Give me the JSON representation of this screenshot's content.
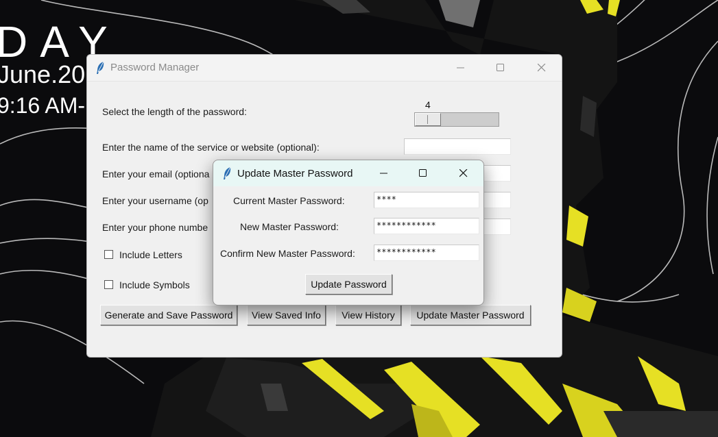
{
  "desktop": {
    "clock_day": "DAY",
    "clock_date": "June.20",
    "clock_time": "9:16 AM-"
  },
  "main_window": {
    "title": "Password Manager",
    "length_label": "Select the length of the password:",
    "length_value": "4",
    "service_label": "Enter the name of the service or website (optional):",
    "email_label": "Enter your email (optiona",
    "username_label": "Enter your username (op",
    "phone_label": "Enter your phone numbe",
    "include_letters": "Include Letters",
    "include_symbols": "Include Symbols",
    "buttons": {
      "generate": "Generate and Save Password",
      "view_saved": "View Saved Info",
      "view_history": "View History",
      "update_master": "Update Master Password"
    }
  },
  "dialog": {
    "title": "Update Master Password",
    "current_label": "Current Master Password:",
    "current_value": "****",
    "new_label": "New Master Password:",
    "new_value": "************",
    "confirm_label": "Confirm New Master Password:",
    "confirm_value": "************",
    "update_button": "Update Password"
  },
  "window_controls": {
    "minimize_icon": "minimize-icon",
    "maximize_icon": "maximize-icon",
    "close_icon": "close-icon"
  },
  "colors": {
    "wallpaper": "#0b0b0d",
    "wallpaper_accent": "#e6e024",
    "dialog_titlebar": "#e8f7f5",
    "window_bg": "#f0f0f0"
  }
}
